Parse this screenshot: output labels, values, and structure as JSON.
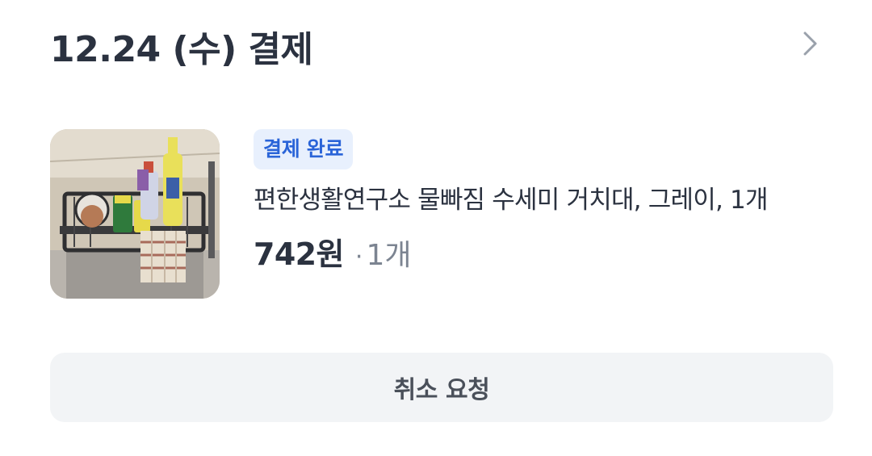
{
  "header": {
    "title": "12.24 (수) 결제"
  },
  "order": {
    "status_badge": "결제 완료",
    "product_name": "편한생활연구소 물빠짐 수세미 거치대, 그레이, 1개",
    "price": "742원",
    "separator": "·",
    "quantity": "1개"
  },
  "actions": {
    "cancel_label": "취소 요청"
  },
  "icons": {
    "chevron": "chevron-right-icon"
  },
  "colors": {
    "title": "#2b3240",
    "badge_bg": "#e8f0fd",
    "badge_text": "#2a64d8",
    "muted": "#7c8491",
    "button_bg": "#f2f4f6"
  }
}
